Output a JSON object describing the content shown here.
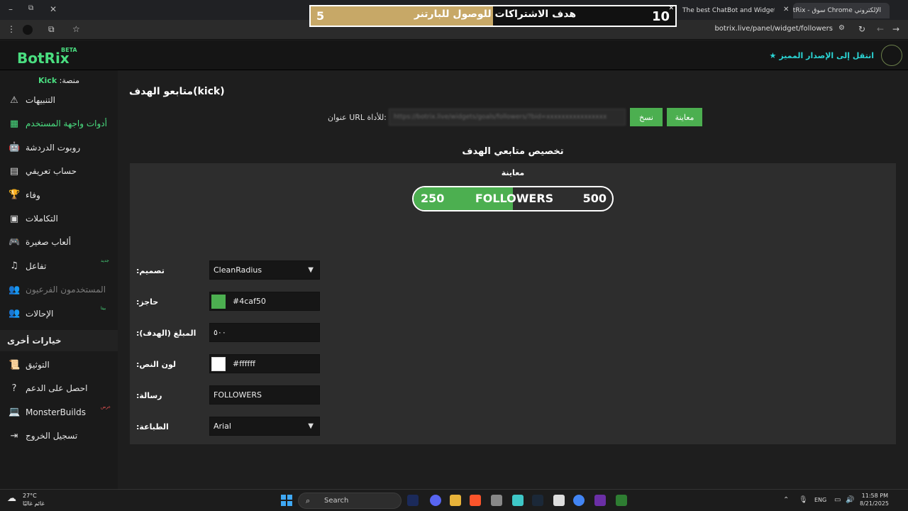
{
  "browser": {
    "tabs": [
      {
        "title": "الإلكتروني Chrome سوق - BotRix"
      },
      {
        "title": "The best ChatBot and Widgets"
      }
    ],
    "url": "botrix.live/panel/widget/followers",
    "window_controls": {
      "minimize": "–",
      "restore": "⧉",
      "close": "✕"
    }
  },
  "overlay_goal": {
    "current": "5",
    "title": "هدف الاشتراكات للوصول للبارتنر",
    "goal": "10",
    "progress_fraction": 0.5,
    "fill_color": "#c7a867"
  },
  "header": {
    "logo": "BotRix",
    "beta": "BETA",
    "premium_link": "انتقل إلى الإصدار المميز"
  },
  "sidebar": {
    "platform_label": "منصة:",
    "platform_name": "Kick",
    "items": [
      {
        "label": "التنبيهات",
        "icon": "warning-icon",
        "glyph": "⚠"
      },
      {
        "label": "أدوات واجهة المستخدم",
        "icon": "widgets-icon",
        "glyph": "▦",
        "active": true
      },
      {
        "label": "روبوت الدردشة",
        "icon": "robot-icon",
        "glyph": "🤖"
      },
      {
        "label": "حساب تعريفي",
        "icon": "id-card-icon",
        "glyph": "▤"
      },
      {
        "label": "وفاء",
        "icon": "trophy-icon",
        "glyph": "🏆"
      },
      {
        "label": "التكاملات",
        "icon": "chat-icon",
        "glyph": "▣"
      },
      {
        "label": "ألعاب صغيرة",
        "icon": "gamepad-icon",
        "glyph": "🎮"
      },
      {
        "label": "تفاعل",
        "icon": "music-icon",
        "glyph": "♫",
        "badge": "جديد"
      },
      {
        "label": "المستخدمون الفرعيون",
        "icon": "users-icon",
        "glyph": "👥",
        "disabled": true
      },
      {
        "label": "الإحالات",
        "icon": "referral-icon",
        "glyph": "👥",
        "badge": "بيتا"
      }
    ],
    "other_options": "خيارات أخرى",
    "other_items": [
      {
        "label": "التوثيق",
        "icon": "scroll-icon",
        "glyph": "📜"
      },
      {
        "label": "احصل على الدعم",
        "icon": "help-icon",
        "glyph": "?"
      },
      {
        "label": "MonsterBuilds",
        "icon": "laptop-icon",
        "glyph": "💻",
        "badge": "عرض"
      },
      {
        "label": "تسجيل الخروج",
        "icon": "logout-icon",
        "glyph": "⇥"
      }
    ]
  },
  "main": {
    "title": "متابعو الهدف(kick)",
    "url_label": "عنوان URL للأداة:",
    "url_value": "https://botrix.live/widgets/goals/followers/?bid=xxxxxxxxxxxxxxxx",
    "copy_button": "نسخ",
    "preview_button": "معاينة",
    "customize_heading": "تخصيص متابعي الهدف",
    "preview_label": "معاينة",
    "goal_preview": {
      "current": "250",
      "message": "FOLLOWERS",
      "target": "500",
      "progress_fraction": 0.5,
      "fill_color": "#4caf50"
    },
    "fields": {
      "design_label": "تصميم:",
      "design_value": "CleanRadius",
      "bar_label": "حاجز:",
      "bar_value": "#4caf50",
      "amount_label": "المبلغ (الهدف):",
      "amount_value": "٥٠٠",
      "text_color_label": "لون النص:",
      "text_color_value": "#ffffff",
      "message_label": "رسالة:",
      "message_value": "FOLLOWERS",
      "font_label": "الطباعة:",
      "font_value": "Arial"
    }
  },
  "taskbar": {
    "weather_temp": "27°C",
    "weather_condition": "غائم غالبًا",
    "search_placeholder": "Search",
    "language": "ENG",
    "time": "11:58 PM",
    "date": "8/21/2025"
  }
}
